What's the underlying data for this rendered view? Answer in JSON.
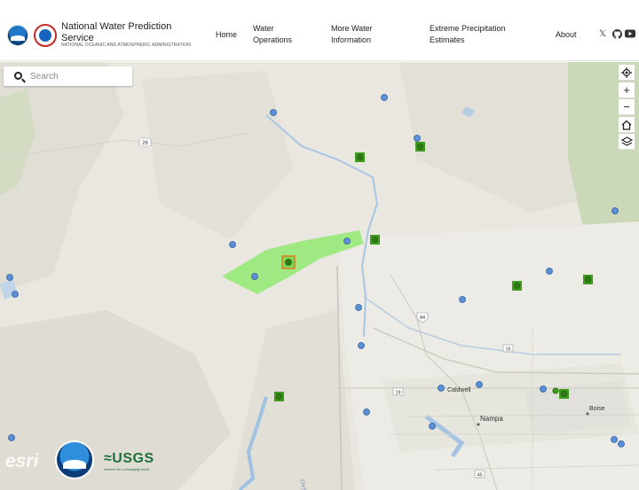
{
  "header": {
    "site_title": "National Water Prediction Service",
    "site_subtitle": "NATIONAL OCEANIC AND ATMOSPHERIC ADMINISTRATION",
    "logo_left": "noaa-logo",
    "logo_right": "nws-logo",
    "nav": {
      "home": "Home",
      "water_operations": "Water Operations",
      "more_water_information": "More Water Information",
      "extreme_precipitation": "Extreme Precipitation Estimates",
      "about": "About"
    },
    "social": {
      "x": "𝕏",
      "github": "github-icon",
      "youtube": "youtube-icon"
    }
  },
  "search": {
    "placeholder": "Search"
  },
  "map_controls": {
    "locate": "locate-icon",
    "zoom_in": "+",
    "zoom_out": "−",
    "home": "home-icon",
    "layers": "layers-icon"
  },
  "map_labels": {
    "highway_26": "26",
    "highway_84": "84",
    "highway_16": "16",
    "highway_19": "19",
    "highway_45": "45",
    "caldwell": "Caldwell",
    "nampa": "Nampa",
    "boise": "Boise",
    "river": "Owyhee"
  },
  "attribution": {
    "esri": "esri",
    "noaa": "NOAA",
    "usgs": "≈USGS",
    "usgs_tagline": "science for a changing world"
  },
  "colors": {
    "gauge_blue": "#5b8fd6",
    "gauge_green": "#3f9b1f",
    "selected_outline": "#e07a1f",
    "flood_polygon": "#7fea5a"
  }
}
